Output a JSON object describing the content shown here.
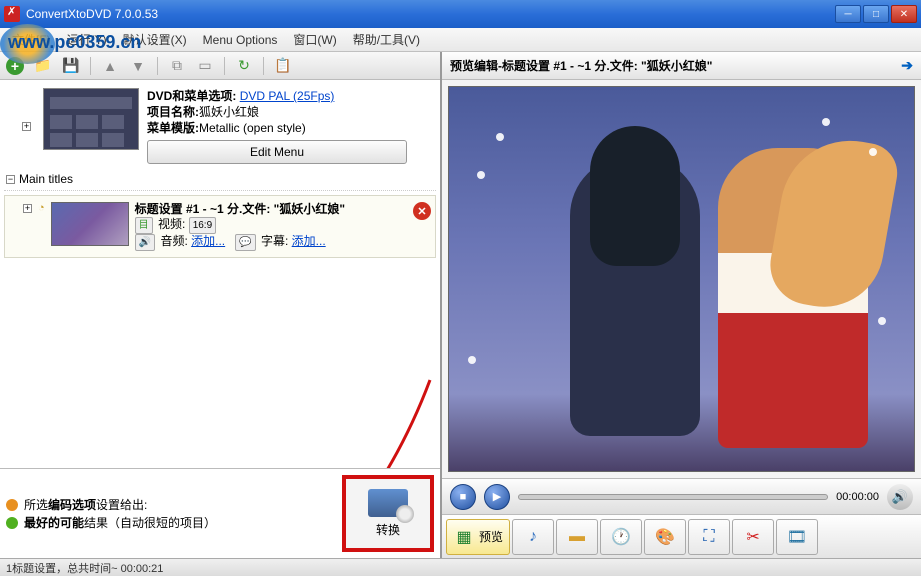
{
  "window": {
    "title": "ConvertXtoDVD 7.0.0.53"
  },
  "menu": {
    "file": "文件[F)",
    "run": "运行(Y)",
    "defaults": "默认设置(X)",
    "options": "Menu Options",
    "window": "窗口(W)",
    "help": "帮助/工具(V)"
  },
  "watermark": "www.pc0359.cn",
  "dvd": {
    "label_options": "DVD和菜单选项:",
    "link": "DVD PAL (25Fps)",
    "label_name": "项目名称:",
    "name": "狐妖小红娘",
    "label_template": "菜单模版:",
    "template": "Metallic (open style)",
    "edit_menu": "Edit Menu"
  },
  "tree": {
    "main_titles": "Main titles",
    "title1": {
      "header": "标题设置 #1 - ~1 分.文件: \"狐妖小红娘\"",
      "video_label": "视频:",
      "video_val": "16:9",
      "audio_label": "音频:",
      "audio_add": "添加...",
      "sub_label": "字幕:",
      "sub_add": "添加..."
    }
  },
  "encoding": {
    "line1_a": "所选",
    "line1_b": "编码选项",
    "line1_c": "设置给出:",
    "line2_a": "最好的可能",
    "line2_b": "结果（自动很短的项目）"
  },
  "convert": {
    "label": "转换"
  },
  "preview": {
    "header": "预览编辑-标题设置 #1 - ~1 分.文件: \"狐妖小红娘\"",
    "time": "00:00:00"
  },
  "tabs": {
    "preview": "预览"
  },
  "status": "1标题设置，总共时间~ 00:00:21"
}
